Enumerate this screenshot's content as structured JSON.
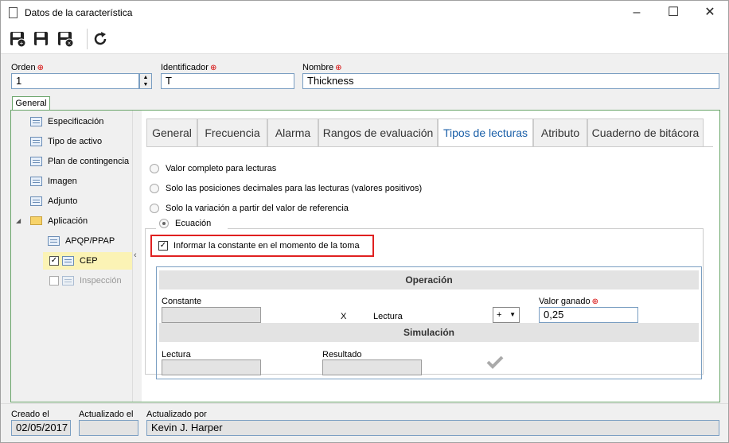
{
  "window": {
    "title": "Datos de la característica"
  },
  "header": {
    "orden_label": "Orden",
    "orden_value": "1",
    "identificador_label": "Identificador",
    "identificador_value": "T",
    "nombre_label": "Nombre",
    "nombre_value": "Thickness"
  },
  "general_tab": "General",
  "tree": {
    "items": [
      {
        "label": "Especificación"
      },
      {
        "label": "Tipo de activo"
      },
      {
        "label": "Plan de contingencia"
      },
      {
        "label": "Imagen"
      },
      {
        "label": "Adjunto"
      },
      {
        "label": "Aplicación"
      },
      {
        "label": "APQP/PPAP"
      },
      {
        "label": "CEP"
      },
      {
        "label": "Inspección"
      }
    ]
  },
  "tabs": [
    {
      "label": "General"
    },
    {
      "label": "Frecuencia"
    },
    {
      "label": "Alarma"
    },
    {
      "label": "Rangos de evaluación"
    },
    {
      "label": "Tipos de lecturas"
    },
    {
      "label": "Atributo"
    },
    {
      "label": "Cuaderno de bitácora"
    }
  ],
  "options": {
    "opt1": "Valor completo para lecturas",
    "opt2": "Solo las posiciones decimales para las lecturas (valores positivos)",
    "opt3": "Solo la variación a partir del valor de referencia",
    "opt4": "Ecuación",
    "checkbox": "Informar la constante en el momento de la toma"
  },
  "operacion": {
    "title": "Operación",
    "constante_label": "Constante",
    "x": "X",
    "lectura_label": "Lectura",
    "operator": "+",
    "valor_ganado_label": "Valor ganado",
    "valor_ganado_value": "0,25"
  },
  "simulacion": {
    "title": "Simulación",
    "lectura_label": "Lectura",
    "resultado_label": "Resultado"
  },
  "footer": {
    "creado_label": "Creado el",
    "creado_value": "02/05/2017",
    "actualizado_label": "Actualizado el",
    "actualizado_value": "",
    "actualizado_por_label": "Actualizado por",
    "actualizado_por_value": "Kevin J. Harper"
  },
  "colors": {
    "active_tab": "#1a5fa8",
    "highlight": "#e02020",
    "required": "#d40000"
  }
}
